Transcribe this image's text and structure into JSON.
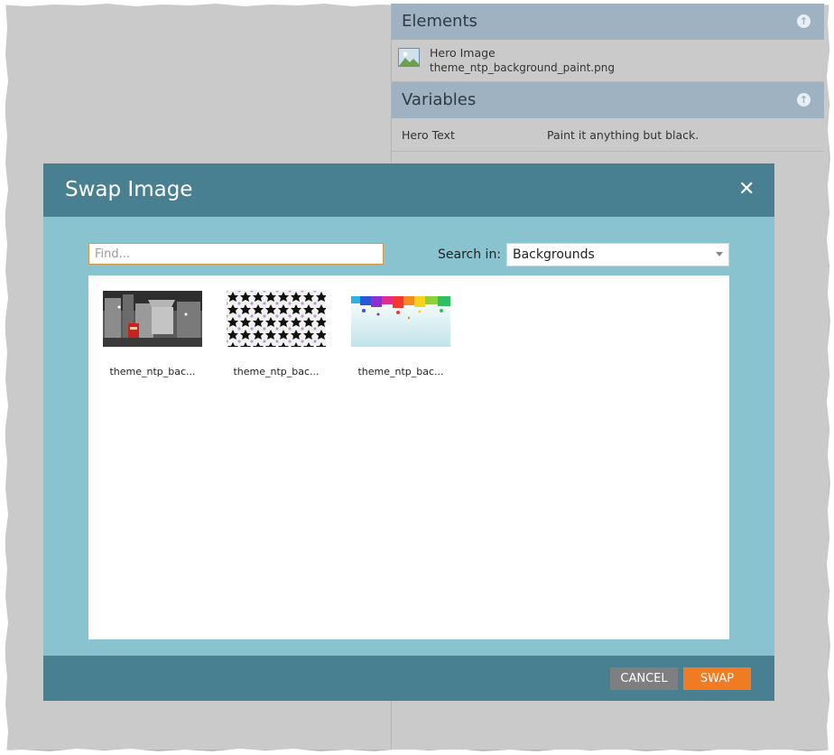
{
  "panel": {
    "elements_header": "Elements",
    "element": {
      "name": "Hero Image",
      "file": "theme_ntp_background_paint.png"
    },
    "variables_header": "Variables",
    "variable": {
      "name": "Hero Text",
      "value": "Paint it anything but black."
    }
  },
  "modal": {
    "title": "Swap Image",
    "close_icon": "close-icon",
    "find_placeholder": "Find...",
    "search_in_label": "Search in:",
    "search_in_value": "Backgrounds",
    "images": [
      {
        "caption": "theme_ntp_bac..."
      },
      {
        "caption": "theme_ntp_bac..."
      },
      {
        "caption": "theme_ntp_bac..."
      }
    ],
    "cancel_label": "CANCEL",
    "swap_label": "SWAP"
  },
  "colors": {
    "modal_header": "#487f91",
    "modal_body": "#89c3d0",
    "swap_button": "#f07b22",
    "cancel_button": "#7f7f7f",
    "panel_header": "#9fb2c1"
  }
}
